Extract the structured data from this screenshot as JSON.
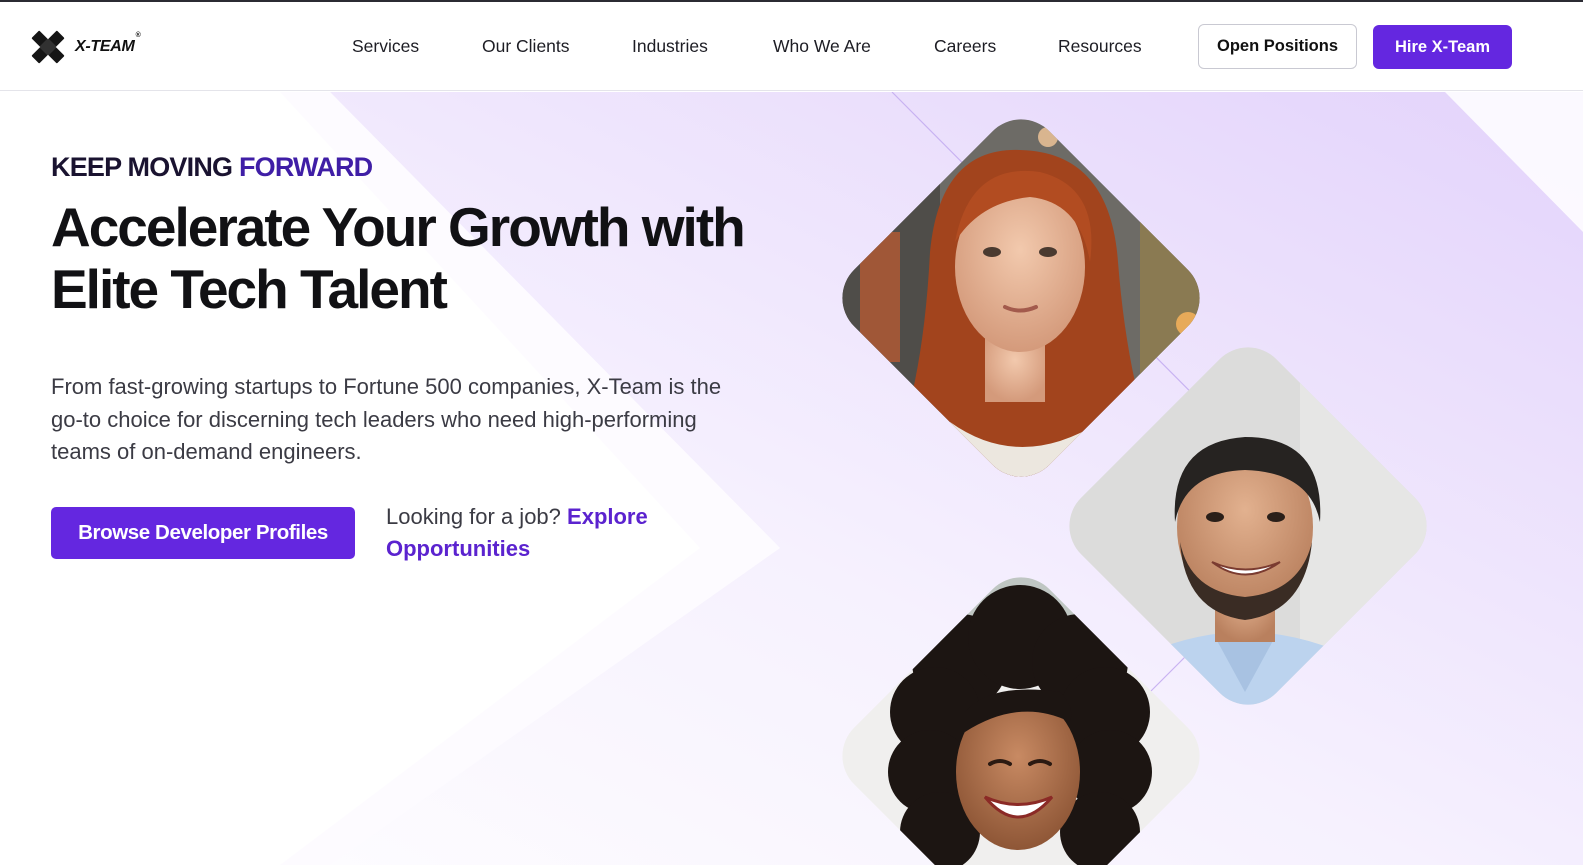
{
  "brand": {
    "name": "X-TEAM",
    "reg_mark": "®",
    "accent_color": "#6427e0",
    "dark_accent": "#3f1ea6"
  },
  "nav": {
    "items": [
      {
        "label": "Services"
      },
      {
        "label": "Our Clients"
      },
      {
        "label": "Industries"
      },
      {
        "label": "Who We Are"
      },
      {
        "label": "Careers"
      },
      {
        "label": "Resources"
      }
    ],
    "open_positions": "Open Positions",
    "hire": "Hire X-Team"
  },
  "hero": {
    "eyebrow_part1": "KEEP MOVING",
    "eyebrow_part2": "FORWARD",
    "headline": "Accelerate Your Growth with Elite Tech Talent",
    "lead": "From fast-growing startups to Fortune 500 companies, X-Team is the go-to choice for discerning tech leaders who need high-performing teams of on-demand engineers.",
    "cta_button": "Browse Developer Profiles",
    "job_prompt": "Looking for a job?",
    "job_link": "Explore Opportunities"
  },
  "photos": [
    {
      "icon": "woman-red-hair-portrait"
    },
    {
      "icon": "smiling-man-portrait"
    },
    {
      "icon": "laughing-woman-curly-hair-portrait"
    }
  ]
}
